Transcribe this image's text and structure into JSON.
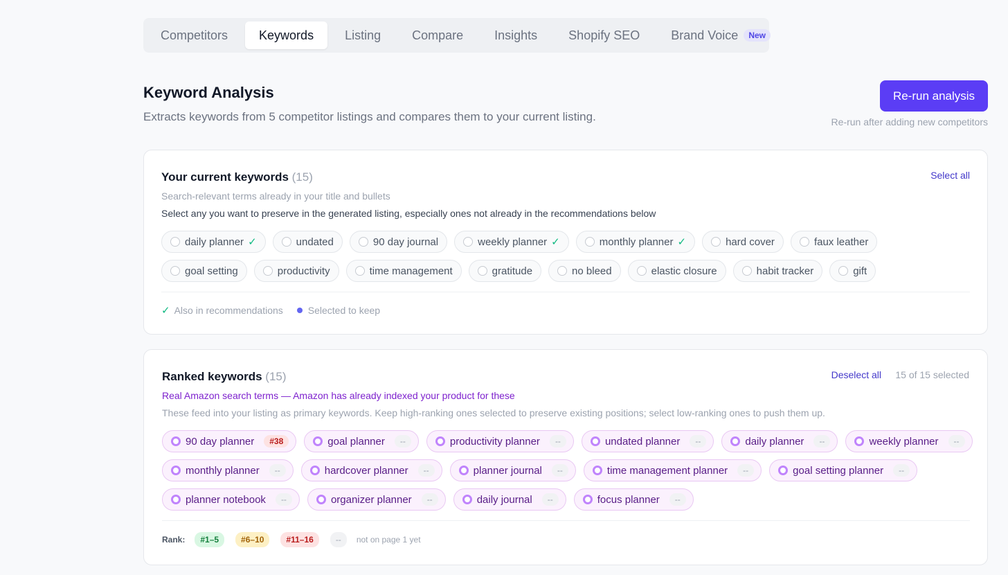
{
  "tabs": [
    {
      "label": "Competitors"
    },
    {
      "label": "Keywords",
      "active": true
    },
    {
      "label": "Listing"
    },
    {
      "label": "Compare"
    },
    {
      "label": "Insights"
    },
    {
      "label": "Shopify SEO"
    },
    {
      "label": "Brand Voice",
      "badge": "New"
    }
  ],
  "header": {
    "title": "Keyword Analysis",
    "subtitle": "Extracts keywords from 5 competitor listings and compares them to your current listing.",
    "rerun_label": "Re-run analysis",
    "rerun_hint": "Re-run after adding new competitors"
  },
  "current": {
    "title": "Your current keywords",
    "count": "(15)",
    "select_all": "Select all",
    "desc1": "Search-relevant terms already in your title and bullets",
    "desc2": "Select any you want to preserve in the generated listing, especially ones not already in the recommendations below",
    "row1": [
      {
        "label": "daily planner",
        "check": "✓"
      },
      {
        "label": "undated",
        "check": ""
      },
      {
        "label": "90 day journal",
        "check": ""
      },
      {
        "label": "weekly planner",
        "check": "✓"
      },
      {
        "label": "monthly planner",
        "check": "✓"
      },
      {
        "label": "hard cover",
        "check": ""
      },
      {
        "label": "faux leather",
        "check": ""
      }
    ],
    "row2": [
      {
        "label": "goal setting",
        "check": ""
      },
      {
        "label": "productivity",
        "check": ""
      },
      {
        "label": "time management",
        "check": ""
      },
      {
        "label": "gratitude",
        "check": ""
      },
      {
        "label": "no bleed",
        "check": ""
      },
      {
        "label": "elastic closure",
        "check": ""
      },
      {
        "label": "habit tracker",
        "check": ""
      },
      {
        "label": "gift",
        "check": ""
      }
    ],
    "legend_check": "✓",
    "legend_also": "Also in recommendations",
    "legend_selected": "Selected to keep"
  },
  "ranked": {
    "title": "Ranked keywords",
    "count": "(15)",
    "deselect_all": "Deselect all",
    "selected_count": "15 of 15 selected",
    "desc1": "Real Amazon search terms — Amazon has already indexed your product for these",
    "desc2": "These feed into your listing as primary keywords. Keep high-ranking ones selected to preserve existing positions; select low-ranking ones to push them up.",
    "row1": [
      {
        "label": "90 day planner",
        "rank": "#38",
        "tone": "red"
      },
      {
        "label": "goal planner",
        "rank": "--"
      },
      {
        "label": "productivity planner",
        "rank": "--"
      },
      {
        "label": "undated planner",
        "rank": "--"
      },
      {
        "label": "daily planner",
        "rank": "--"
      },
      {
        "label": "weekly planner",
        "rank": "--"
      }
    ],
    "row2": [
      {
        "label": "monthly planner",
        "rank": "--"
      },
      {
        "label": "hardcover planner",
        "rank": "--"
      },
      {
        "label": "planner journal",
        "rank": "--"
      },
      {
        "label": "time management planner",
        "rank": "--"
      },
      {
        "label": "goal setting planner",
        "rank": "--"
      }
    ],
    "row3": [
      {
        "label": "planner notebook",
        "rank": "--"
      },
      {
        "label": "organizer planner",
        "rank": "--"
      },
      {
        "label": "daily journal",
        "rank": "--"
      },
      {
        "label": "focus planner",
        "rank": "--"
      }
    ],
    "rank_legend": {
      "label": "Rank:",
      "green": "#1–5",
      "yellow": "#6–10",
      "red": "#11–16",
      "none": "--",
      "note": "not on page 1 yet"
    }
  },
  "colors": {
    "accent": "#5b3df5",
    "check": "#10b981",
    "ranked_text": "#7e22ce"
  }
}
